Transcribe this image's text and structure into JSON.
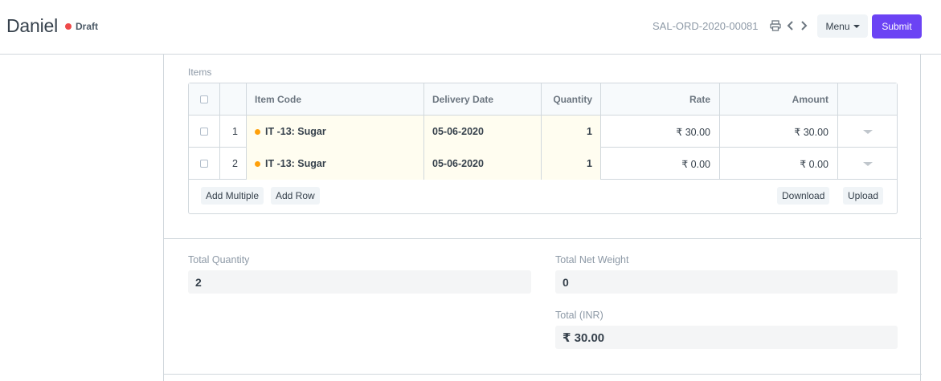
{
  "header": {
    "title": "Daniel",
    "status": "Draft",
    "status_color": "#ef4a4a",
    "doc_name": "SAL-ORD-2020-00081",
    "menu_label": "Menu",
    "submit_label": "Submit",
    "submit_color": "#6b43f4"
  },
  "items": {
    "label": "Items",
    "columns": {
      "item_code": "Item Code",
      "delivery_date": "Delivery Date",
      "quantity": "Quantity",
      "rate": "Rate",
      "amount": "Amount"
    },
    "rows": [
      {
        "idx": "1",
        "item_code": "IT -13: Sugar",
        "delivery_date": "05-06-2020",
        "quantity": "1",
        "rate": "₹ 30.00",
        "amount": "₹ 30.00"
      },
      {
        "idx": "2",
        "item_code": "IT -13: Sugar",
        "delivery_date": "05-06-2020",
        "quantity": "1",
        "rate": "₹ 0.00",
        "amount": "₹ 0.00"
      }
    ],
    "buttons": {
      "add_multiple": "Add Multiple",
      "add_row": "Add Row",
      "download": "Download",
      "upload": "Upload"
    }
  },
  "totals": {
    "total_quantity_label": "Total Quantity",
    "total_quantity": "2",
    "total_net_weight_label": "Total Net Weight",
    "total_net_weight": "0",
    "total_label": "Total (INR)",
    "total": "₹ 30.00"
  }
}
